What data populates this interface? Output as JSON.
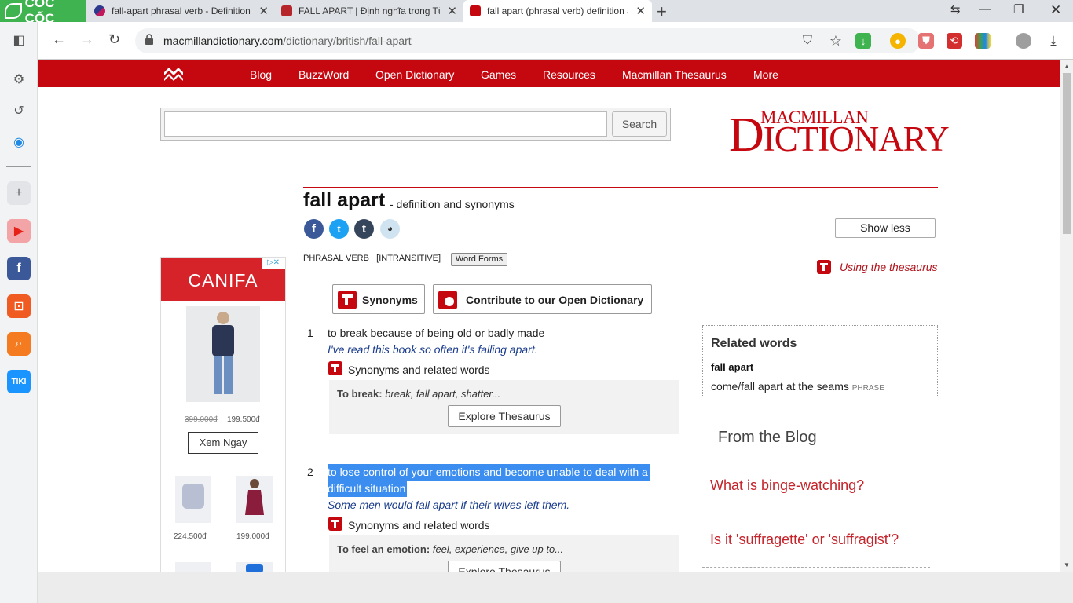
{
  "browser": {
    "brand": "CỐC CỐC",
    "tabs": [
      {
        "title": "fall-apart phrasal verb - Definition"
      },
      {
        "title": "FALL APART | Định nghĩa trong Từ"
      },
      {
        "title": "fall apart (phrasal verb) definition a"
      }
    ],
    "url_host": "macmillandictionary.com",
    "url_path": "/dictionary/british/fall-apart",
    "colors": {
      "tabbar": "#dee1e6",
      "brand": "#3fb34f",
      "accent": "#c5080f"
    }
  },
  "site": {
    "nav": [
      "Blog",
      "BuzzWord",
      "Open Dictionary",
      "Games",
      "Resources",
      "Macmillan Thesaurus",
      "More"
    ],
    "search_button": "Search",
    "search_value": "",
    "brand_line1": "MACMILLAN",
    "brand_line2_big": "D",
    "brand_line2_rest": "ICTIONARY"
  },
  "entry": {
    "headword": "fall apart",
    "subtitle": "- definition and synonyms",
    "show_less": "Show less",
    "part_of_speech": "PHRASAL VERB",
    "grammar": "[INTRANSITIVE]",
    "word_forms": "Word Forms",
    "using_thesaurus": "Using the thesaurus",
    "synonyms_button": "Synonyms",
    "contribute_button": "Contribute to our Open Dictionary",
    "senses": [
      {
        "num": "1",
        "def": "to break because of being old or badly made",
        "example": "I've read this book so often it's falling apart.",
        "syn_head": "Synonyms and related words",
        "syn_label": "To break:",
        "syn_list": "break, fall apart, shatter...",
        "explore": "Explore Thesaurus"
      },
      {
        "num": "2",
        "def_line1": "to lose control of your emotions and become unable to deal with a",
        "def_line2": "difficult situation",
        "example": "Some men would fall apart if their wives left them.",
        "syn_head": "Synonyms and related words",
        "syn_label": "To feel an emotion:",
        "syn_list": "feel, experience, give up to...",
        "explore": "Explore Thesaurus"
      }
    ]
  },
  "related": {
    "title": "Related words",
    "item1": "fall apart",
    "item2": "come/fall apart at the seams",
    "item2_tag": "PHRASE"
  },
  "blog": {
    "title": "From the Blog",
    "links": [
      "What is binge-watching?",
      "Is it 'suffragette' or 'suffragist'?"
    ]
  },
  "ad": {
    "brand": "CANIFA",
    "old_price": "399.000đ",
    "new_price": "199.500đ",
    "cta": "Xem Ngay",
    "price2": "224.500đ",
    "price3": "199.000đ"
  }
}
